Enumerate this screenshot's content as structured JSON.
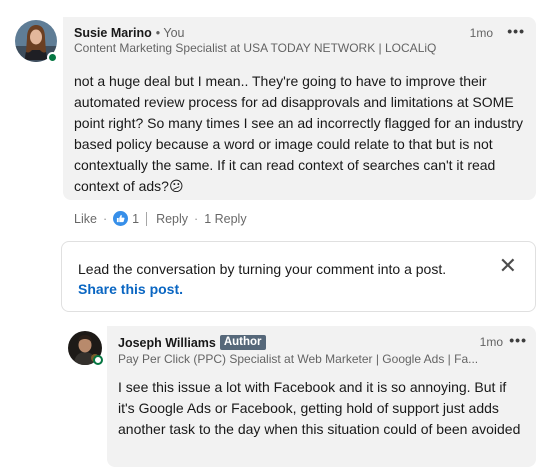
{
  "comment": {
    "author_name": "Susie Marino",
    "you_label": "• You",
    "headline": "Content Marketing Specialist at USA TODAY NETWORK | LOCALiQ",
    "time": "1mo",
    "more_label": "•••",
    "text": "not a huge deal but I mean.. They're going to have to improve their automated review process for ad disapprovals and limitations at SOME point right? So many times I see an ad incorrectly flagged for an industry based policy because a word or image could relate to that but is not contextually the same. If it can read context of searches can't it read context of ads?",
    "emoji": "😕",
    "actions": {
      "like_label": "Like",
      "reaction_count": "1",
      "reply_label": "Reply",
      "reply_count": "1 Reply"
    }
  },
  "promo": {
    "text": "Lead the conversation by turning your comment into a post.",
    "link": "Share this post.",
    "close_label": "✕"
  },
  "reply": {
    "author_name": "Joseph Williams",
    "badge": "Author",
    "headline": "Pay Per Click (PPC) Specialist at Web Marketer | Google Ads | Fa...",
    "time": "1mo",
    "more_label": "•••",
    "text": "I see this issue a lot with Facebook and it is so annoying. But if it's Google Ads or Facebook, getting hold of support just adds another task to the day when this situation could of been avoided"
  },
  "colors": {
    "bubble_bg": "#f2f2f2",
    "link_blue": "#0a66c2",
    "like_blue": "#378fe9",
    "presence_green": "#057642",
    "author_badge": "#56687a"
  }
}
